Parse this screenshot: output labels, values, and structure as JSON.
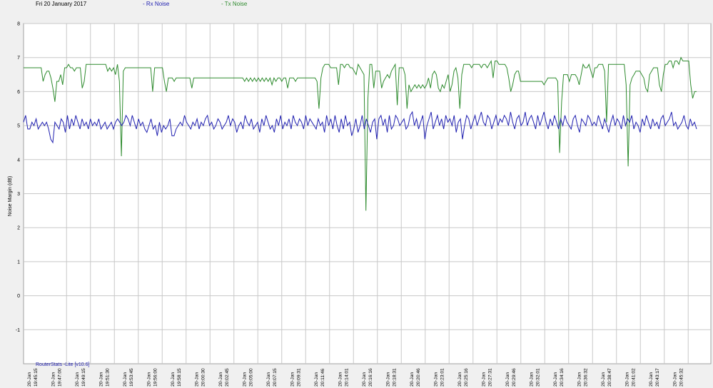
{
  "header": {
    "date": "Fri 20 January 2017",
    "legend_rx": "Rx Noise",
    "legend_tx": "Tx Noise"
  },
  "footer_text": "RouterStats -Lite [v10.6]",
  "colors": {
    "rx": "#1f1fb0",
    "tx": "#2e8b2e",
    "grid": "#c8c8c8",
    "plot_bg": "#ffffff"
  },
  "chart_data": {
    "type": "line",
    "title": "",
    "ylabel": "Noise Margin (dB)",
    "ylim": [
      -2,
      8
    ],
    "yticks": [
      -1,
      0,
      1,
      2,
      3,
      4,
      5,
      6,
      7,
      8
    ],
    "grid": true,
    "legend_placement": "top",
    "x_tick_labels": [
      [
        "20-Jan",
        "19:45:15"
      ],
      [
        "20-Jan",
        "19:47:00"
      ],
      [
        "20-Jan",
        "19:49:15"
      ],
      [
        "20-Jan",
        "19:51:30"
      ],
      [
        "20-Jan",
        "19:53:45"
      ],
      [
        "20-Jan",
        "19:56:00"
      ],
      [
        "20-Jan",
        "19:58:15"
      ],
      [
        "20-Jan",
        "20:00:30"
      ],
      [
        "20-Jan",
        "20:02:45"
      ],
      [
        "20-Jan",
        "20:05:00"
      ],
      [
        "20-Jan",
        "20:07:15"
      ],
      [
        "20-Jan",
        "20:09:31"
      ],
      [
        "20-Jan",
        "20:11:46"
      ],
      [
        "20-Jan",
        "20:14:01"
      ],
      [
        "20-Jan",
        "20:16:16"
      ],
      [
        "20-Jan",
        "20:18:31"
      ],
      [
        "20-Jan",
        "20:20:46"
      ],
      [
        "20-Jan",
        "20:23:01"
      ],
      [
        "20-Jan",
        "20:25:16"
      ],
      [
        "20-Jan",
        "20:27:31"
      ],
      [
        "20-Jan",
        "20:29:46"
      ],
      [
        "20-Jan",
        "20:32:01"
      ],
      [
        "20-Jan",
        "20:34:16"
      ],
      [
        "20-Jan",
        "20:36:32"
      ],
      [
        "20-Jan",
        "20:38:47"
      ],
      [
        "20-Jan",
        "20:41:02"
      ],
      [
        "20-Jan",
        "20:43:17"
      ],
      [
        "20-Jan",
        "20:45:32"
      ]
    ],
    "series": [
      {
        "name": "Rx Noise",
        "values": [
          5.1,
          5.3,
          4.9,
          4.9,
          5.1,
          5.0,
          5.2,
          4.9,
          5.0,
          5.1,
          5.0,
          5.1,
          4.9,
          4.6,
          4.5,
          5.1,
          5.0,
          4.9,
          5.2,
          5.1,
          4.8,
          5.3,
          4.9,
          5.2,
          5.0,
          5.3,
          5.1,
          4.9,
          5.2,
          5.0,
          5.1,
          4.9,
          5.2,
          5.0,
          5.1,
          5.0,
          5.2,
          4.9,
          5.0,
          5.1,
          4.9,
          5.0,
          5.1,
          4.9,
          5.1,
          5.2,
          5.1,
          5.0,
          5.1,
          5.3,
          5.2,
          5.0,
          5.3,
          5.1,
          4.9,
          5.2,
          5.0,
          5.1,
          4.9,
          4.8,
          5.0,
          5.2,
          4.9,
          5.0,
          4.7,
          5.1,
          4.8,
          5.0,
          4.9,
          5.0,
          5.2,
          4.7,
          4.7,
          4.9,
          5.0,
          5.1,
          5.0,
          5.3,
          5.1,
          5.0,
          4.9,
          5.1,
          5.0,
          5.2,
          4.9,
          5.1,
          5.0,
          5.2,
          5.3,
          5.0,
          5.1,
          4.9,
          5.0,
          5.2,
          5.1,
          4.9,
          5.0,
          5.1,
          5.3,
          5.0,
          5.2,
          5.1,
          4.8,
          5.0,
          5.1,
          4.9,
          5.3,
          5.1,
          5.0,
          5.2,
          4.9,
          5.0,
          5.1,
          4.8,
          5.2,
          5.0,
          5.3,
          5.1,
          4.9,
          5.0,
          4.8,
          5.2,
          5.0,
          5.3,
          4.9,
          5.1,
          5.0,
          5.2,
          4.9,
          5.3,
          5.1,
          5.0,
          5.2,
          5.1,
          4.9,
          5.3,
          5.0,
          5.2,
          5.1,
          5.0,
          4.9,
          5.2,
          5.0,
          5.1,
          4.8,
          5.3,
          5.0,
          5.2,
          4.9,
          5.3,
          5.0,
          4.8,
          5.2,
          4.9,
          5.3,
          5.0,
          5.1,
          4.7,
          4.9,
          5.2,
          4.8,
          5.0,
          5.3,
          4.9,
          5.2,
          5.0,
          4.8,
          5.1,
          5.2,
          4.6,
          5.2,
          5.3,
          5.0,
          5.2,
          4.8,
          5.3,
          4.9,
          5.0,
          5.3,
          5.2,
          5.0,
          5.1,
          5.2,
          4.9,
          5.0,
          5.3,
          5.4,
          5.0,
          5.2,
          4.9,
          5.1,
          5.3,
          4.6,
          5.0,
          5.2,
          5.4,
          4.9,
          5.1,
          5.3,
          5.0,
          5.2,
          4.9,
          5.3,
          5.1,
          5.2,
          5.0,
          5.3,
          4.8,
          5.1,
          5.2,
          4.6,
          5.0,
          5.3,
          5.2,
          4.9,
          5.1,
          5.3,
          5.0,
          5.2,
          5.4,
          5.1,
          5.0,
          5.3,
          5.2,
          4.9,
          5.1,
          5.3,
          5.0,
          5.2,
          5.1,
          5.3,
          5.2,
          5.0,
          5.4,
          5.1,
          4.9,
          5.2,
          5.3,
          5.0,
          5.1,
          5.4,
          5.0,
          5.2,
          5.3,
          5.1,
          4.9,
          5.3,
          5.0,
          5.2,
          5.4,
          5.1,
          4.9,
          5.2,
          5.0,
          5.3,
          5.1,
          4.9,
          5.2,
          5.0,
          5.3,
          5.1,
          5.0,
          4.9,
          5.2,
          5.3,
          5.0,
          4.8,
          5.2,
          5.1,
          5.0,
          5.3,
          5.2,
          5.0,
          5.1,
          5.0,
          5.3,
          5.1,
          4.9,
          5.2,
          5.0,
          4.8,
          5.1,
          5.3,
          5.0,
          5.2,
          5.1,
          4.9,
          5.3,
          5.0,
          5.2,
          5.1,
          5.3,
          4.9,
          5.1,
          5.0,
          4.8,
          5.2,
          5.0,
          5.3,
          5.1,
          4.9,
          5.2,
          5.0,
          5.1,
          4.9,
          5.2,
          5.3,
          5.0,
          5.1,
          5.2,
          5.4,
          5.0,
          5.1,
          4.9,
          5.0,
          5.1,
          5.3,
          5.0,
          4.9,
          5.2,
          5.0,
          5.1,
          4.9
        ]
      },
      {
        "name": "Tx Noise",
        "values": [
          6.7,
          6.7,
          6.7,
          6.7,
          6.7,
          6.7,
          6.7,
          6.7,
          6.7,
          6.7,
          6.3,
          6.5,
          6.6,
          6.6,
          6.4,
          6.1,
          5.7,
          6.3,
          6.3,
          6.5,
          6.2,
          6.7,
          6.7,
          6.8,
          6.7,
          6.7,
          6.6,
          6.7,
          6.7,
          6.7,
          6.1,
          6.3,
          6.8,
          6.8,
          6.8,
          6.8,
          6.8,
          6.8,
          6.8,
          6.8,
          6.8,
          6.8,
          6.8,
          6.6,
          6.7,
          6.6,
          6.7,
          6.5,
          6.8,
          6.3,
          4.1,
          6.6,
          6.7,
          6.7,
          6.7,
          6.7,
          6.7,
          6.7,
          6.7,
          6.7,
          6.7,
          6.7,
          6.7,
          6.7,
          6.7,
          6.7,
          6.0,
          6.7,
          6.7,
          6.7,
          6.7,
          6.7,
          6.3,
          6.0,
          6.4,
          6.4,
          6.4,
          6.3,
          6.4,
          6.4,
          6.4,
          6.4,
          6.4,
          6.4,
          6.4,
          6.4,
          6.1,
          6.4,
          6.4,
          6.4,
          6.4,
          6.4,
          6.4,
          6.4,
          6.4,
          6.4,
          6.4,
          6.4,
          6.4,
          6.4,
          6.4,
          6.4,
          6.4,
          6.4,
          6.4,
          6.4,
          6.4,
          6.4,
          6.4,
          6.4,
          6.4,
          6.4,
          6.4,
          6.3,
          6.4,
          6.3,
          6.4,
          6.3,
          6.4,
          6.3,
          6.4,
          6.3,
          6.4,
          6.3,
          6.4,
          6.3,
          6.4,
          6.2,
          6.4,
          6.3,
          6.4,
          6.4,
          6.3,
          6.4,
          6.4,
          6.1,
          6.4,
          6.4,
          6.4,
          6.3,
          6.4,
          6.4,
          6.4,
          6.4,
          6.4,
          6.4,
          6.4,
          6.4,
          6.4,
          6.4,
          6.3,
          5.5,
          6.4,
          6.7,
          6.8,
          6.8,
          6.8,
          6.7,
          6.7,
          6.7,
          6.7,
          6.2,
          6.8,
          6.8,
          6.7,
          6.8,
          6.8,
          6.7,
          6.7,
          6.6,
          6.5,
          6.8,
          6.7,
          6.6,
          6.5,
          2.5,
          5.8,
          6.8,
          6.8,
          6.1,
          6.6,
          6.6,
          6.6,
          6.1,
          6.3,
          6.4,
          6.5,
          6.4,
          6.6,
          6.7,
          6.8,
          5.6,
          6.7,
          6.7,
          6.7,
          6.5,
          5.5,
          6.2,
          6.0,
          6.1,
          6.2,
          6.1,
          6.2,
          6.1,
          6.2,
          6.1,
          6.2,
          6.4,
          6.1,
          6.5,
          6.6,
          6.5,
          6.1,
          6.0,
          6.2,
          6.1,
          6.3,
          6.5,
          6.0,
          6.2,
          6.6,
          6.7,
          6.4,
          5.5,
          6.5,
          6.8,
          6.8,
          6.8,
          6.8,
          6.7,
          6.8,
          6.8,
          6.8,
          6.8,
          6.7,
          6.8,
          6.8,
          6.7,
          6.8,
          6.9,
          6.4,
          6.9,
          6.9,
          6.8,
          6.8,
          6.8,
          6.8,
          6.7,
          6.4,
          6.0,
          6.2,
          6.5,
          6.6,
          6.6,
          6.3,
          6.3,
          6.3,
          6.3,
          6.3,
          6.3,
          6.3,
          6.3,
          6.3,
          6.3,
          6.3,
          6.3,
          6.2,
          6.3,
          6.4,
          6.4,
          6.4,
          6.4,
          6.4,
          6.3,
          4.2,
          5.7,
          6.5,
          6.5,
          6.5,
          6.3,
          6.5,
          6.5,
          6.5,
          6.4,
          6.2,
          6.5,
          6.8,
          6.7,
          6.7,
          6.8,
          6.6,
          6.4,
          6.7,
          6.7,
          6.8,
          6.8,
          6.8,
          6.6,
          5.1,
          6.8,
          6.8,
          6.8,
          6.8,
          6.8,
          6.8,
          6.8,
          6.8,
          6.8,
          6.2,
          3.8,
          6.2,
          6.4,
          6.5,
          6.6,
          6.6,
          6.6,
          6.5,
          6.4,
          6.1,
          6.0,
          6.5,
          6.6,
          6.7,
          6.7,
          6.7,
          6.2,
          6.0,
          6.5,
          6.8,
          6.8,
          6.9,
          6.9,
          6.7,
          6.9,
          6.9,
          6.8,
          7.0,
          6.9,
          6.9,
          6.9,
          6.9,
          6.2,
          5.8,
          6.0,
          6.0
        ]
      }
    ]
  }
}
